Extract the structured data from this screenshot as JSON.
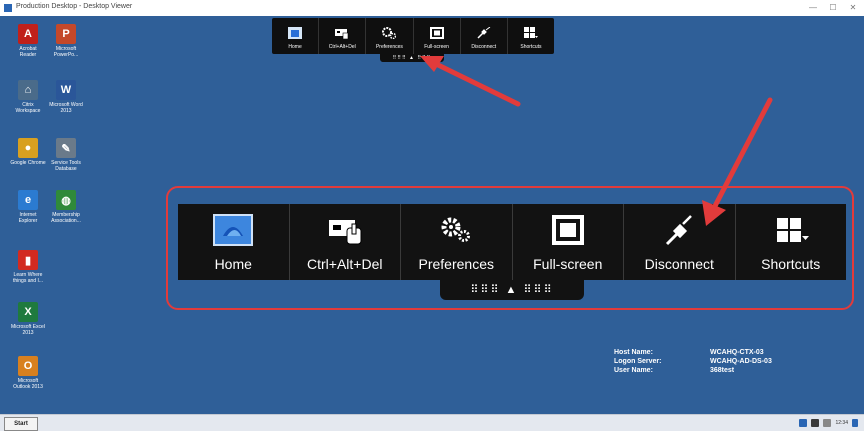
{
  "window": {
    "title": "Production Desktop - Desktop Viewer",
    "minimize": "—",
    "restore": "☐",
    "close": "✕"
  },
  "desktop_icons": [
    {
      "label": "Acrobat\nReader",
      "glyph": "A",
      "color": "#c0201b",
      "icon": "acrobat-reader-icon"
    },
    {
      "label": "Microsoft\nPowerPo...",
      "glyph": "P",
      "color": "#c4482a",
      "icon": "powerpoint-icon"
    },
    {
      "label": "Citrix\nWorkspace",
      "glyph": "⌂",
      "color": "#4a6b8a",
      "icon": "citrix-workspace-icon"
    },
    {
      "label": "Microsoft Word\n2013",
      "glyph": "W",
      "color": "#2a5699",
      "icon": "word-icon"
    },
    {
      "label": "Google Chrome",
      "glyph": "●",
      "color": "#d8a020",
      "icon": "chrome-icon"
    },
    {
      "label": "Service Tools\nDatabase",
      "glyph": "✎",
      "color": "#6a7a8a",
      "icon": "service-tools-icon"
    },
    {
      "label": "Internet\nExplorer",
      "glyph": "e",
      "color": "#2b7bd1",
      "icon": "internet-explorer-icon"
    },
    {
      "label": "Membership\nAssociation...",
      "glyph": "◍",
      "color": "#2f8a3a",
      "icon": "globe-icon"
    },
    {
      "label": "Learn Where\nthings and I...",
      "glyph": "▮",
      "color": "#d22a20",
      "icon": "document-icon"
    },
    {
      "label": "Microsoft Excel\n2013",
      "glyph": "X",
      "color": "#1f7a3e",
      "icon": "excel-icon"
    },
    {
      "label": "Microsoft\nOutlook 2013",
      "glyph": "O",
      "color": "#d8801f",
      "icon": "outlook-icon"
    }
  ],
  "toolbar": {
    "buttons": [
      {
        "name": "home",
        "label": "Home"
      },
      {
        "name": "ctrl-alt-del",
        "label": "Ctrl+Alt+Del"
      },
      {
        "name": "preferences",
        "label": "Preferences"
      },
      {
        "name": "full-screen",
        "label": "Full-screen"
      },
      {
        "name": "disconnect",
        "label": "Disconnect"
      },
      {
        "name": "shortcuts",
        "label": "Shortcuts"
      }
    ],
    "handle": "⠿⠿⠿ ▲ ⠿⠿⠿"
  },
  "host_info": [
    {
      "key": "Host Name:",
      "value": "WCAHQ-CTX-03"
    },
    {
      "key": "Logon Server:",
      "value": "WCAHQ-AD-DS-03"
    },
    {
      "key": "User Name:",
      "value": "368test"
    }
  ],
  "taskbar": {
    "start": "Start",
    "clock": "12:34"
  },
  "colors": {
    "desktop": "#2f5f98",
    "toolbar": "#121212",
    "highlight": "#e23b3b"
  }
}
